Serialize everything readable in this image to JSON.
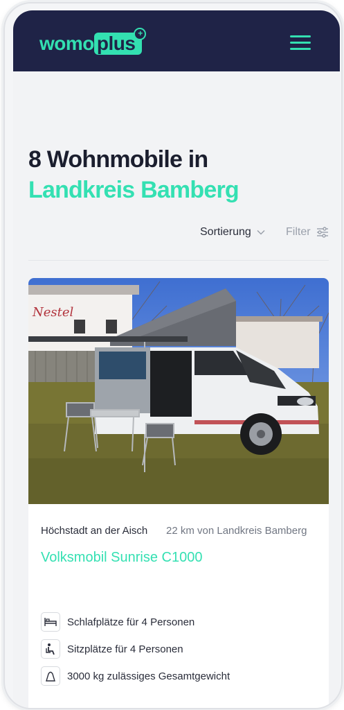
{
  "header": {
    "logo_text_a": "womo",
    "logo_text_b": "plus",
    "logo_plus": "+",
    "menu_icon": "hamburger-icon",
    "brand_color": "#33e0b1",
    "background": "#1f2347"
  },
  "main": {
    "title_line1": "8 Wohnmobile in",
    "title_line2": "Landkreis Bamberg",
    "sort_label": "Sortierung",
    "filter_label": "Filter"
  },
  "listing": {
    "location": "Höchstadt an der Aisch",
    "distance": "22 km von Landkreis Bamberg",
    "name": "Volksmobil Sunrise C1000",
    "features": [
      {
        "icon": "bed-icon",
        "label": "Schlafplätze für 4 Personen"
      },
      {
        "icon": "seat-icon",
        "label": "Sitzplätze für 4 Personen"
      },
      {
        "icon": "weight-icon",
        "label": "3000 kg zulässiges Gesamtgewicht"
      }
    ]
  }
}
